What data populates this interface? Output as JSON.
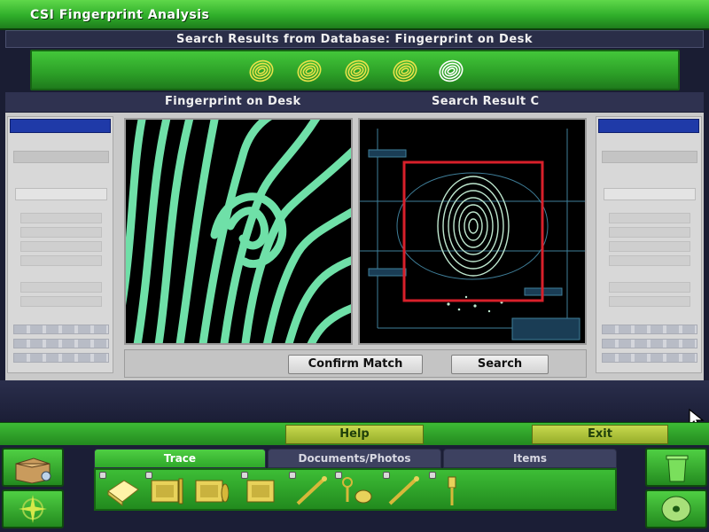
{
  "app": {
    "title": "CSI Fingerprint Analysis"
  },
  "results": {
    "header": "Search Results from Database:  Fingerprint on Desk",
    "thumbnails": [
      {
        "icon": "fingerprint-icon",
        "color": "#e8e24a",
        "selected": false
      },
      {
        "icon": "fingerprint-icon",
        "color": "#e8e24a",
        "selected": false
      },
      {
        "icon": "fingerprint-icon",
        "color": "#e8e24a",
        "selected": false
      },
      {
        "icon": "fingerprint-icon",
        "color": "#e8e24a",
        "selected": false
      },
      {
        "icon": "fingerprint-icon",
        "color": "#ffffff",
        "selected": true
      }
    ]
  },
  "panels": {
    "left_title": "Fingerprint on Desk",
    "right_title": "Search Result C"
  },
  "actions": {
    "confirm_label": "Confirm Match",
    "search_label": "Search"
  },
  "footer": {
    "help_label": "Help",
    "exit_label": "Exit"
  },
  "inventory": {
    "tabs": [
      {
        "label": "Trace",
        "active": true
      },
      {
        "label": "Documents/Photos",
        "active": false
      },
      {
        "label": "Items",
        "active": false
      }
    ],
    "items": [
      {
        "icon": "note-pad-icon",
        "locked": true
      },
      {
        "icon": "evidence-card-icon",
        "locked": true
      },
      {
        "icon": "evidence-card-icon",
        "locked": false
      },
      {
        "icon": "evidence-card-icon",
        "locked": true
      },
      {
        "icon": "pry-tool-icon",
        "locked": true
      },
      {
        "icon": "keys-icon",
        "locked": true
      },
      {
        "icon": "pry-tool-icon",
        "locked": true
      },
      {
        "icon": "brush-icon",
        "locked": true
      }
    ]
  },
  "colors": {
    "accent_green": "#2fae2a",
    "highlight_red": "#d8202a",
    "print_green": "#6fe0a8",
    "panel_blue": "#1f3aa8"
  }
}
